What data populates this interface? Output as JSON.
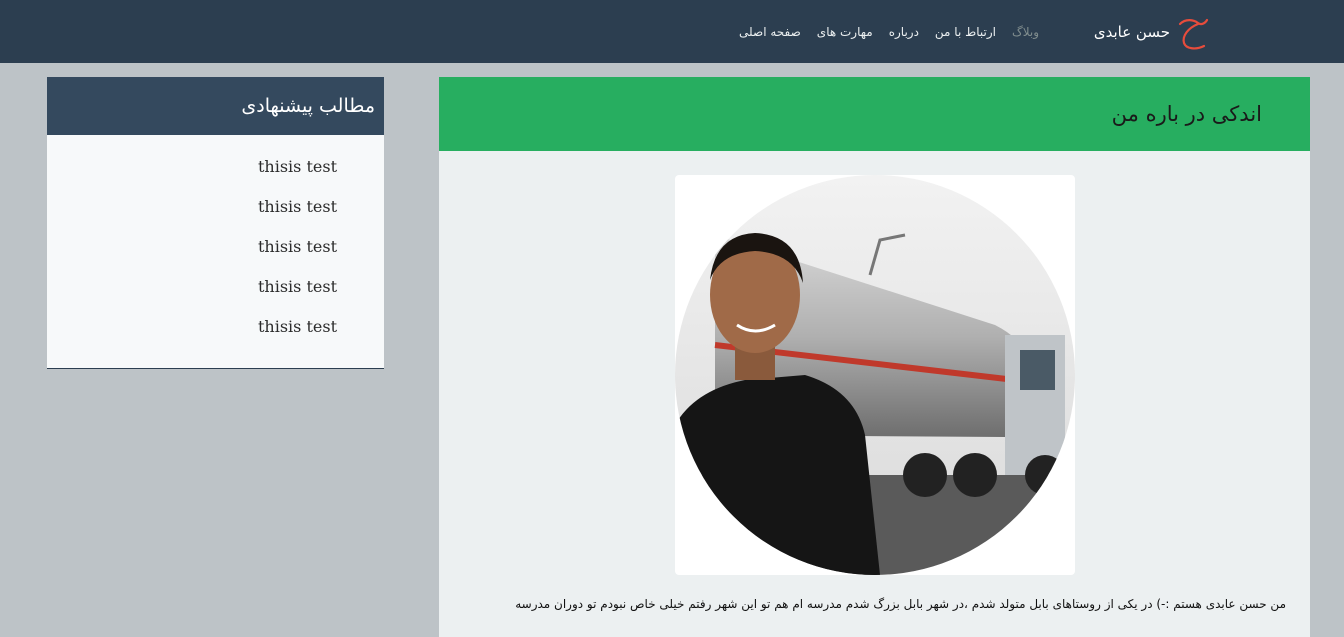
{
  "nav": {
    "brand_name": "حسن عابدی",
    "logo_icon": "calligraphy-h-logo",
    "links": [
      {
        "label": "صفحه اصلی"
      },
      {
        "label": "مهارت های"
      },
      {
        "label": "درباره"
      },
      {
        "label": "ارتباط با من"
      },
      {
        "label": "وبلاگ"
      }
    ]
  },
  "main": {
    "title": "اندکی در باره من",
    "bio": "من حسن عابدی هستم :-) در یکی از روستاهای بابل متولد شدم ،در شهر بابل بزرگ شدم مدرسه ام هم تو این شهر رفتم خیلی خاص نبودم تو دوران مدرسه"
  },
  "sidebar": {
    "title": "مطالب پیشنهادی",
    "items": [
      {
        "label": "thisis test"
      },
      {
        "label": "thisis test"
      },
      {
        "label": "thisis test"
      },
      {
        "label": "thisis test"
      },
      {
        "label": "thisis test"
      }
    ]
  },
  "colors": {
    "navbar": "#2c3e50",
    "header_green": "#27ae60",
    "sidebar_header": "#34495e",
    "page_bg": "#bdc3c7",
    "logo_red": "#e74c3c"
  }
}
